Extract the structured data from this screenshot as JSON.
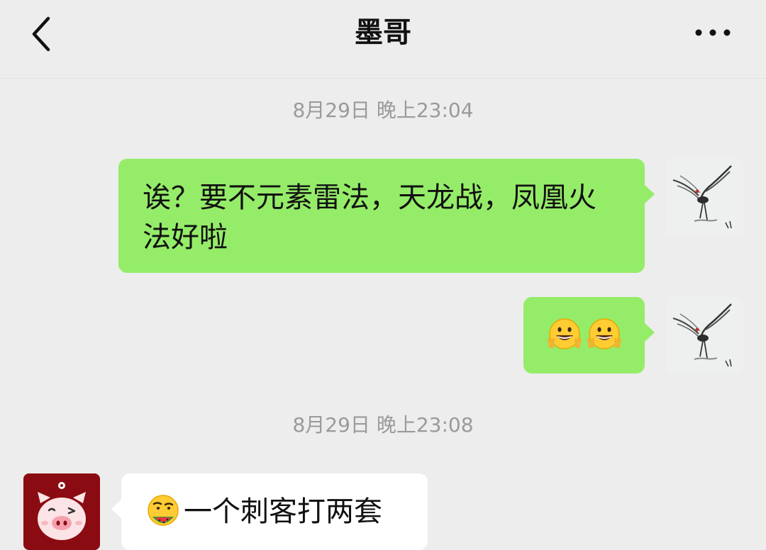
{
  "header": {
    "title": "墨哥",
    "back_icon": "chevron-left-icon",
    "more_icon": "more-dots-icon"
  },
  "messages": [
    {
      "type": "timestamp",
      "text": "8月29日 晚上23:04"
    },
    {
      "type": "outgoing",
      "text": "诶？要不元素雷法，天龙战，凤凰火法好啦"
    },
    {
      "type": "outgoing",
      "emoji": [
        "grin-peace-emoji",
        "grin-peace-emoji"
      ]
    },
    {
      "type": "timestamp",
      "text": "8月29日 晚上23:08"
    },
    {
      "type": "incoming",
      "emoji": "eating-watermelon-emoji",
      "text": "一个刺客打两套"
    }
  ],
  "colors": {
    "background": "#ededed",
    "outgoing_bubble": "#95ec69",
    "incoming_bubble": "#ffffff",
    "timestamp": "#9a9a9a",
    "other_avatar_bg": "#8a0c12"
  }
}
